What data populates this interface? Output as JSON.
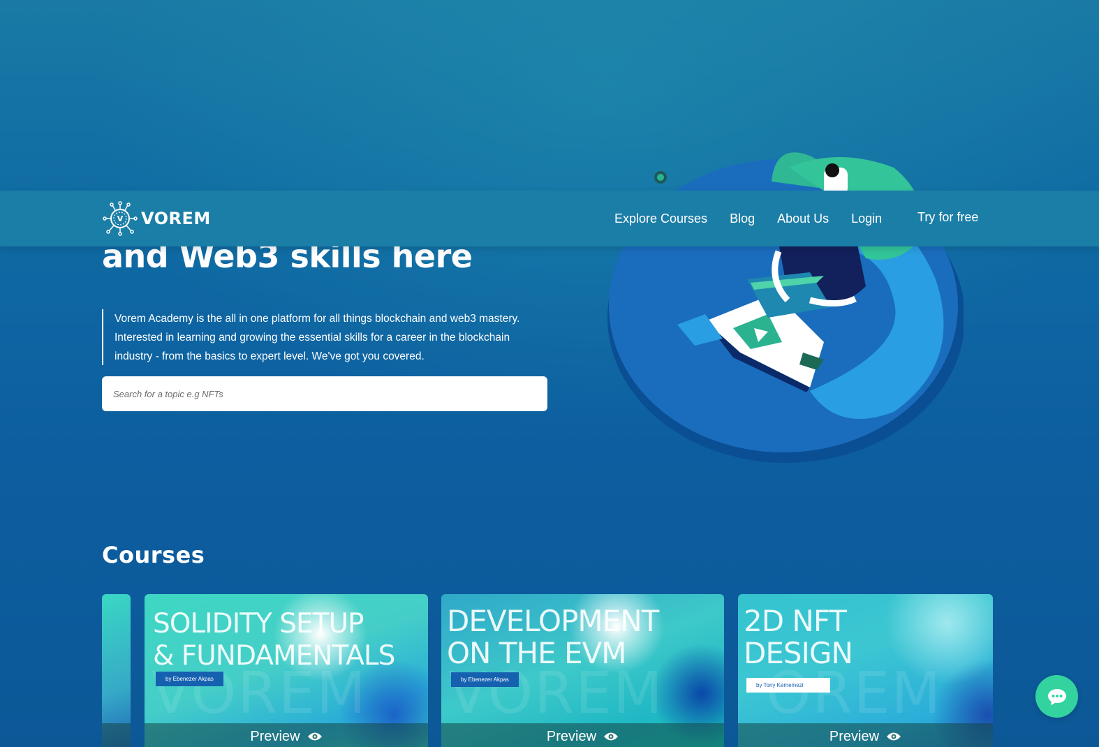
{
  "brand": {
    "name": "VOREM"
  },
  "nav": {
    "links": [
      "Explore Courses",
      "Blog",
      "About Us",
      "Login"
    ],
    "cta": "Try for free"
  },
  "hero": {
    "title": "and Web3 skills here",
    "description": "Vorem Academy is the all in one platform for all things blockchain and web3 mastery. Interested in learning and growing the essential skills for a career in the blockchain industry - from the basics to expert level. We've got you covered.",
    "search_placeholder": "Search for a topic e.g NFTs"
  },
  "courses": {
    "heading": "Courses",
    "cards": [
      {
        "title_line1": "SOLIDITY SETUP",
        "title_line2": "& FUNDAMENTALS",
        "author": "by Ebenezer Akpas",
        "preview": "Preview"
      },
      {
        "title_line1": "DEVELOPMENT",
        "title_line2": "ON THE EVM",
        "author": "by Ebenezer Akpas",
        "preview": "Preview"
      },
      {
        "title_line1": "2D NFT",
        "title_line2": "DESIGN",
        "author": "by Tony Kememezi",
        "preview": "Preview"
      }
    ]
  },
  "colors": {
    "accent": "#33d3a0",
    "navbar": "#1b7ea7",
    "background": "#0f6aa3"
  },
  "icons": [
    "vorem-logo-icon",
    "eye-icon",
    "chat-icon"
  ]
}
